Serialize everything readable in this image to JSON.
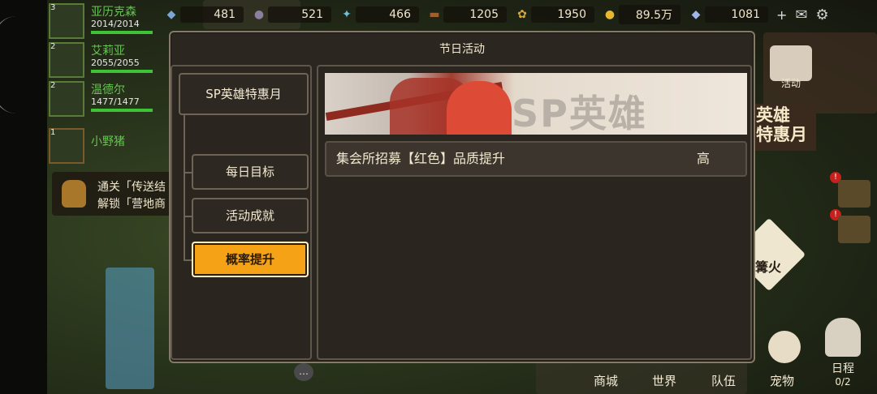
{
  "topbar": {
    "resources": [
      {
        "icon": "crystal-icon",
        "value": "481"
      },
      {
        "icon": "ore-icon",
        "value": "521"
      },
      {
        "icon": "gem-cluster-icon",
        "value": "466"
      },
      {
        "icon": "wood-icon",
        "value": "1205"
      },
      {
        "icon": "wheat-icon",
        "value": "1950"
      },
      {
        "icon": "gold-coin-icon",
        "value": "89.5万"
      },
      {
        "icon": "diamond-icon",
        "value": "1081"
      }
    ],
    "plus": "+"
  },
  "team": [
    {
      "level": "3",
      "name": "亚历克森",
      "hp": "2014/2014",
      "hp_ratio": 1.0
    },
    {
      "level": "2",
      "name": "艾莉亚",
      "hp": "2055/2055",
      "hp_ratio": 1.0
    },
    {
      "level": "2",
      "name": "温德尔",
      "hp": "1477/1477",
      "hp_ratio": 1.0
    },
    {
      "level": "1",
      "name": "小野猪",
      "hp": "",
      "hp_ratio": null
    }
  ],
  "quest": {
    "line1": "通关「传送结",
    "line2": "解锁「营地商"
  },
  "side": {
    "activity": "活动",
    "banner": "英雄\n特惠月",
    "bonfire": "篝火",
    "schedule": "日程",
    "schedule_count": "0/2"
  },
  "bottom_nav": [
    "商城",
    "世界",
    "队伍",
    "宠物"
  ],
  "dialog": {
    "title": "节日活动",
    "main_tab": "SP英雄特惠月",
    "sub_tabs": [
      "每日目标",
      "活动成就",
      "概率提升"
    ],
    "active_tab_index": 2,
    "banner_text": "SP英雄",
    "rows": [
      {
        "name": "集会所招募【红色】品质提升",
        "level": "高"
      }
    ]
  },
  "colors": {
    "active_tab": "#f5a217",
    "panel_border": "#5e564a",
    "hp_green": "#3ec236"
  }
}
